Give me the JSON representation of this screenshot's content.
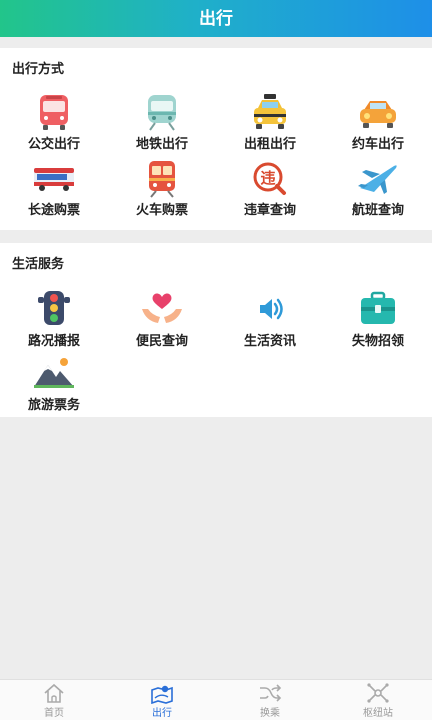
{
  "header": {
    "title": "出行"
  },
  "transport": {
    "title": "出行方式",
    "items": [
      {
        "label": "公交出行",
        "icon": "bus-icon"
      },
      {
        "label": "地铁出行",
        "icon": "subway-icon"
      },
      {
        "label": "出租出行",
        "icon": "taxi-icon"
      },
      {
        "label": "约车出行",
        "icon": "car-icon"
      },
      {
        "label": "长途购票",
        "icon": "coach-icon"
      },
      {
        "label": "火车购票",
        "icon": "train-icon"
      },
      {
        "label": "违章查询",
        "icon": "violation-icon"
      },
      {
        "label": "航班查询",
        "icon": "airplane-icon"
      }
    ]
  },
  "life": {
    "title": "生活服务",
    "items": [
      {
        "label": "路况播报",
        "icon": "traffic-light-icon"
      },
      {
        "label": "便民查询",
        "icon": "heart-hands-icon"
      },
      {
        "label": "生活资讯",
        "icon": "speaker-icon"
      },
      {
        "label": "失物招领",
        "icon": "briefcase-icon"
      },
      {
        "label": "旅游票务",
        "icon": "mountain-icon"
      }
    ]
  },
  "tabbar": {
    "items": [
      {
        "label": "首页",
        "icon": "home-icon",
        "active": false
      },
      {
        "label": "出行",
        "icon": "travel-map-icon",
        "active": true
      },
      {
        "label": "换乘",
        "icon": "shuffle-icon",
        "active": false
      },
      {
        "label": "枢纽站",
        "icon": "hub-icon",
        "active": false
      }
    ]
  },
  "colors": {
    "accent": "#2a6fd8",
    "header_start": "#22c58a",
    "header_end": "#1e8fe8"
  }
}
